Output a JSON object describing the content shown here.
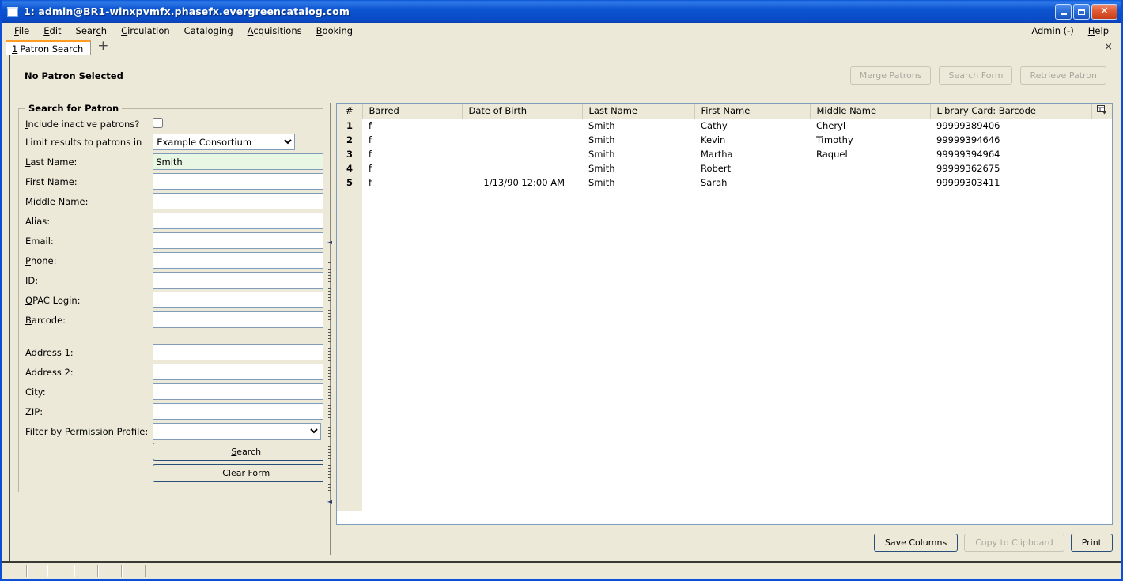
{
  "window": {
    "title": "1: admin@BR1-winxpvmfx.phasefx.evergreencatalog.com",
    "minimize_label": "",
    "maximize_label": "",
    "close_label": "✕"
  },
  "menubar": {
    "items": [
      {
        "label": "File",
        "accel": "F"
      },
      {
        "label": "Edit",
        "accel": "E"
      },
      {
        "label": "Search",
        "accel": "c"
      },
      {
        "label": "Circulation",
        "accel": "C"
      },
      {
        "label": "Cataloging",
        "accel": "g"
      },
      {
        "label": "Acquisitions",
        "accel": "A"
      },
      {
        "label": "Booking",
        "accel": "B"
      }
    ],
    "right_items": [
      {
        "label": "Admin (-)",
        "accel": ""
      },
      {
        "label": "Help",
        "accel": "H"
      }
    ]
  },
  "tabs": {
    "active_number": "1",
    "active_label": "Patron Search",
    "new_tab_label": "+",
    "close_label": "×"
  },
  "patron_bar": {
    "status_label": "No Patron Selected",
    "buttons": [
      {
        "label": "Merge Patrons",
        "disabled": true
      },
      {
        "label": "Search Form",
        "disabled": true
      },
      {
        "label": "Retrieve Patron",
        "disabled": true
      }
    ]
  },
  "search_form": {
    "legend": "Search for Patron",
    "include_inactive_label": "Include inactive patrons?",
    "include_inactive_checked": false,
    "limit_label": "Limit results to patrons in",
    "limit_value": "Example Consortium",
    "fields": [
      {
        "label": "Last Name:",
        "value": "Smith",
        "focused": true
      },
      {
        "label": "First Name:",
        "value": "",
        "focused": false
      },
      {
        "label": "Middle Name:",
        "value": "",
        "focused": false
      },
      {
        "label": "Alias:",
        "value": "",
        "focused": false
      },
      {
        "label": "Email:",
        "value": "",
        "focused": false
      },
      {
        "label": "Phone:",
        "value": "",
        "focused": false
      },
      {
        "label": "ID:",
        "value": "",
        "focused": false
      },
      {
        "label": "OPAC Login:",
        "value": "",
        "focused": false
      },
      {
        "label": "Barcode:",
        "value": "",
        "focused": false
      }
    ],
    "address_fields": [
      {
        "label": "Address 1:",
        "value": ""
      },
      {
        "label": "Address 2:",
        "value": ""
      },
      {
        "label": "City:",
        "value": ""
      },
      {
        "label": "ZIP:",
        "value": ""
      }
    ],
    "permission_label": "Filter by Permission Profile:",
    "permission_value": "",
    "search_button": "Search",
    "clear_button": "Clear Form"
  },
  "results": {
    "columns": [
      "#",
      "Barred",
      "Date of Birth",
      "Last Name",
      "First Name",
      "Middle Name",
      "Library Card: Barcode"
    ],
    "column_picker_icon": "column-picker-icon",
    "rows": [
      {
        "num": "1",
        "barred": "f",
        "dob": "",
        "last": "Smith",
        "first": "Cathy",
        "middle": "Cheryl",
        "barcode": "99999389406"
      },
      {
        "num": "2",
        "barred": "f",
        "dob": "",
        "last": "Smith",
        "first": "Kevin",
        "middle": "Timothy",
        "barcode": "99999394646"
      },
      {
        "num": "3",
        "barred": "f",
        "dob": "",
        "last": "Smith",
        "first": "Martha",
        "middle": "Raquel",
        "barcode": "99999394964"
      },
      {
        "num": "4",
        "barred": "f",
        "dob": "",
        "last": "Smith",
        "first": "Robert",
        "middle": "",
        "barcode": "99999362675"
      },
      {
        "num": "5",
        "barred": "f",
        "dob": "1/13/90 12:00 AM",
        "last": "Smith",
        "first": "Sarah",
        "middle": "",
        "barcode": "99999303411"
      }
    ],
    "buttons": [
      {
        "label": "Save Columns",
        "disabled": false
      },
      {
        "label": "Copy to Clipboard",
        "disabled": true
      },
      {
        "label": "Print",
        "disabled": false
      }
    ]
  },
  "colors": {
    "titlebar_blue": "#0a56d6",
    "window_border": "#0a4fd6",
    "chrome_beige": "#ece9d8",
    "active_tab_accent": "#ff9b21",
    "focused_input_green": "#e7f7e3",
    "control_border": "#7f9db9"
  }
}
